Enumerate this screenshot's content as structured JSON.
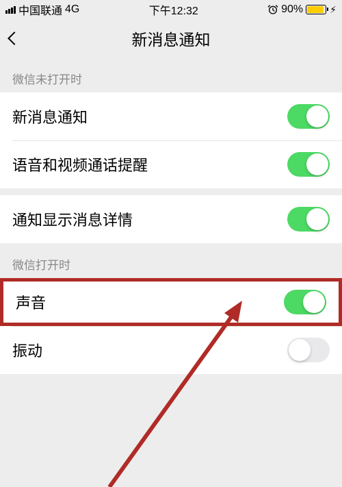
{
  "status_bar": {
    "carrier": "中国联通",
    "network": "4G",
    "time": "下午12:32",
    "alarm_icon": "⏰",
    "battery_percent": "90%"
  },
  "nav": {
    "title": "新消息通知"
  },
  "sections": {
    "closed": {
      "header": "微信未打开时",
      "items": [
        {
          "label": "新消息通知",
          "on": true
        },
        {
          "label": "语音和视频通话提醒",
          "on": true
        }
      ],
      "detail": {
        "label": "通知显示消息详情",
        "on": true
      }
    },
    "open": {
      "header": "微信打开时",
      "items": [
        {
          "label": "声音",
          "on": true,
          "highlight": true
        },
        {
          "label": "振动",
          "on": false
        }
      ]
    }
  }
}
